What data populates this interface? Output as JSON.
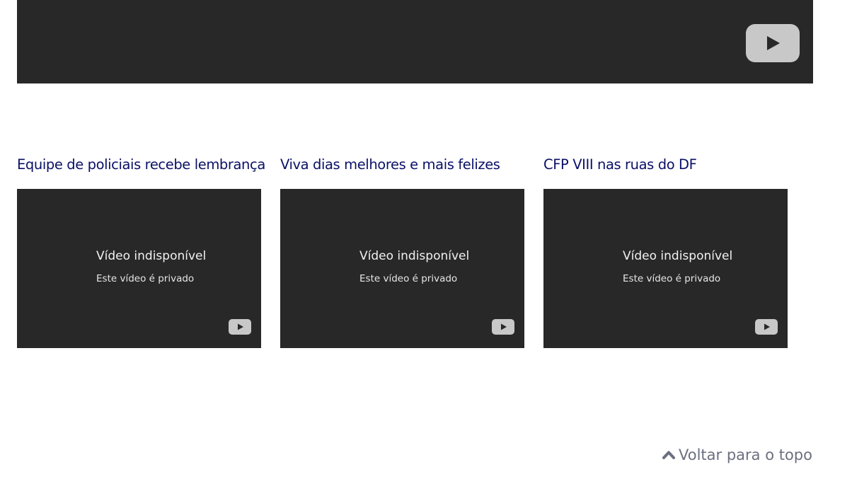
{
  "top_video": {
    "icon": "youtube-play-icon"
  },
  "videos": [
    {
      "title": "Equipe de policiais recebe lembrança",
      "status": "Vídeo indisponível",
      "detail": "Este vídeo é privado"
    },
    {
      "title": "Viva dias melhores e mais felizes",
      "status": "Vídeo indisponível",
      "detail": "Este vídeo é privado"
    },
    {
      "title": "CFP VIII nas ruas do DF",
      "status": "Vídeo indisponível",
      "detail": "Este vídeo é privado"
    }
  ],
  "footer": {
    "back_to_top": "Voltar para o topo",
    "icon": "chevron-up-icon"
  },
  "colors": {
    "title": "#0a1066",
    "player_bg": "#282828",
    "back_to_top": "#6b6f80"
  }
}
